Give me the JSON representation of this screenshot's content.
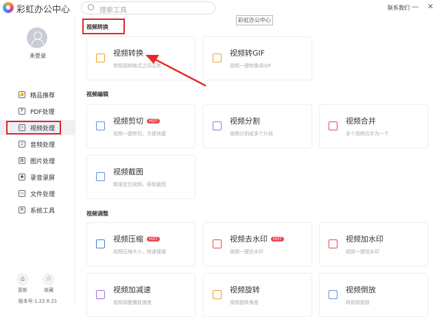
{
  "app": {
    "title": "彩虹办公中心",
    "tooltip": "彩虹办公中心",
    "contact": "联系我们",
    "minimize": "—",
    "close": "✕"
  },
  "search": {
    "placeholder": "搜索工具"
  },
  "user": {
    "name": "未登录"
  },
  "nav": [
    {
      "label": "精品推荐",
      "icon": "thumbs-up-icon",
      "glyph": "👍"
    },
    {
      "label": "PDF处理",
      "icon": "pdf-icon",
      "glyph": "P"
    },
    {
      "label": "视频处理",
      "icon": "video-icon",
      "glyph": "▷"
    },
    {
      "label": "音频处理",
      "icon": "music-icon",
      "glyph": "♫"
    },
    {
      "label": "图片处理",
      "icon": "image-icon",
      "glyph": "▨"
    },
    {
      "label": "录音录屏",
      "icon": "record-icon",
      "glyph": "◉"
    },
    {
      "label": "文件处理",
      "icon": "folder-icon",
      "glyph": "▭"
    },
    {
      "label": "系统工具",
      "icon": "system-icon",
      "glyph": "⚙"
    }
  ],
  "bottom": {
    "update": "更新",
    "favorite": "收藏",
    "version": "版本号:1.22.8.21"
  },
  "sections": [
    {
      "title": "视频转换",
      "cards": [
        {
          "title": "视频转换",
          "desc": "常规视频格式之间互转",
          "color": "#f0a020"
        },
        {
          "title": "视频转GIF",
          "desc": "视频一键转换成GIF",
          "color": "#f0a020"
        }
      ]
    },
    {
      "title": "视频编辑",
      "cards": [
        {
          "title": "视频剪切",
          "desc": "视频一键剪切，方便快捷",
          "hot": "HOT",
          "color": "#5b8fd9"
        },
        {
          "title": "视频分割",
          "desc": "视频分割成多个片段",
          "color": "#9b6ee8"
        },
        {
          "title": "视频合并",
          "desc": "多个视频合并为一个",
          "color": "#e8474d"
        },
        {
          "title": "视频截图",
          "desc": "精准定位视频，获取截图",
          "color": "#5b8fd9"
        }
      ]
    },
    {
      "title": "视频调整",
      "cards": [
        {
          "title": "视频压缩",
          "desc": "视频压缩大小，快速便捷",
          "hot": "HOT",
          "color": "#3a7bd5"
        },
        {
          "title": "视频去水印",
          "desc": "视频一键去水印",
          "hot": "HOT",
          "color": "#e8474d"
        },
        {
          "title": "视频加水印",
          "desc": "视频一键加水印",
          "color": "#e8474d"
        },
        {
          "title": "视频加减速",
          "desc": "视频调整播放速度",
          "color": "#9b6ee8"
        },
        {
          "title": "视频旋转",
          "desc": "视频旋转角度",
          "color": "#f0a020"
        },
        {
          "title": "视频倒放",
          "desc": "将视频倒放",
          "color": "#5b8fd9"
        }
      ]
    }
  ]
}
